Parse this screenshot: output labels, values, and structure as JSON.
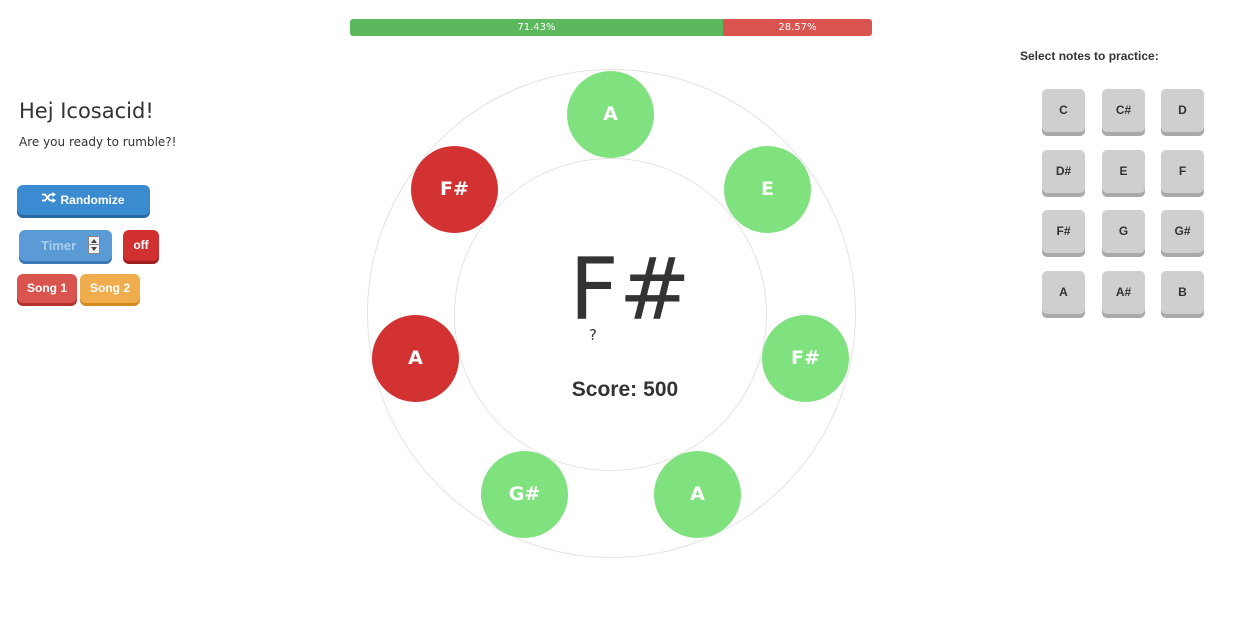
{
  "progress": {
    "correct_label": "71.43%",
    "wrong_label": "28.57%",
    "correct_fraction": 0.7143,
    "wrong_fraction": 0.2857,
    "correct_color": "#5cb85c",
    "wrong_color": "#d9534f"
  },
  "left": {
    "greeting": "Hej Icosacid!",
    "subtitle": "Are you ready to rumble?!",
    "randomize_label": "Randomize",
    "randomize_icon": "shuffle-icon",
    "timer_placeholder": "Timer",
    "timer_toggle_label": "off",
    "song1_label": "Song 1",
    "song2_label": "Song 2"
  },
  "game": {
    "current_note": "F#",
    "hint": "?",
    "score_label": "Score:",
    "score_value": "500",
    "notes": [
      {
        "label": "A",
        "status": "correct"
      },
      {
        "label": "E",
        "status": "correct"
      },
      {
        "label": "F#",
        "status": "correct"
      },
      {
        "label": "A",
        "status": "correct"
      },
      {
        "label": "G#",
        "status": "correct"
      },
      {
        "label": "A",
        "status": "wrong"
      },
      {
        "label": "F#",
        "status": "wrong"
      }
    ],
    "correct_color": "#80e27e",
    "wrong_color": "#d23232"
  },
  "right": {
    "title": "Select notes to practice:",
    "notes": [
      "C",
      "C#",
      "D",
      "D#",
      "E",
      "F",
      "F#",
      "G",
      "G#",
      "A",
      "A#",
      "B"
    ]
  }
}
